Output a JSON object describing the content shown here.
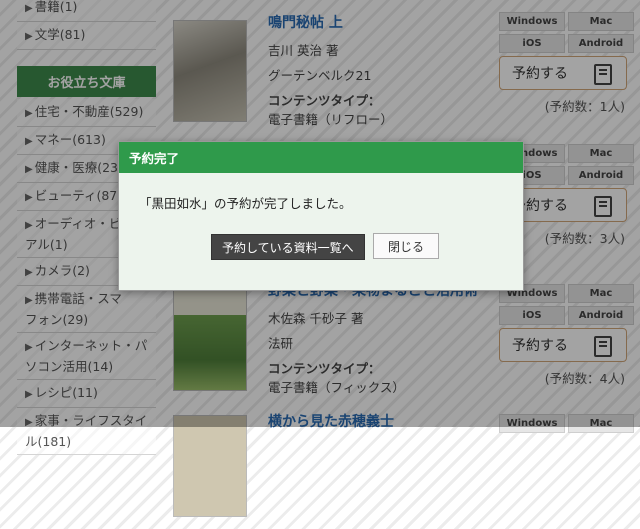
{
  "sidebar": {
    "top_items": [
      {
        "label": "書籍(1)"
      },
      {
        "label": "文学(81)"
      }
    ],
    "section_title": "お役立ち文庫",
    "items": [
      {
        "label": "住宅・不動産(529)"
      },
      {
        "label": "マネー(613)"
      },
      {
        "label": "健康・医療(23"
      },
      {
        "label": "ビューティ(87"
      },
      {
        "label": "オーディオ・ビ\nアル(1)"
      },
      {
        "label": "カメラ(2)"
      },
      {
        "label": "携帯電話・スマ\nフォン(29)"
      },
      {
        "label": "インターネット・パ\nソコン活用(14)"
      },
      {
        "label": "レシピ(11)"
      },
      {
        "label": "家事・ライフスタイ\nル(181)"
      }
    ]
  },
  "platforms": {
    "windows": "Windows",
    "mac": "Mac",
    "ios": "iOS",
    "android": "Android"
  },
  "reserve_label": "予約する",
  "books": [
    {
      "title": "鳴門秘帖 上",
      "author": "吉川 英治 著",
      "publisher": "グーテンベルク21",
      "content_type_label": "コンテンツタイプ：",
      "content_type": "電子書籍（リフロー）",
      "reserve_count": "(予約数：1人)"
    },
    {
      "reserve_count": "(予約数：3人)"
    },
    {
      "title": "野菜と野菜・果物まるごと活用術",
      "author": "木佐森 千砂子 著",
      "publisher": "法研",
      "content_type_label": "コンテンツタイプ：",
      "content_type": "電子書籍（フィックス）",
      "reserve_count": "(予約数：4人)"
    },
    {
      "title": "横から見た赤穂義士"
    }
  ],
  "modal": {
    "title": "予約完了",
    "message": "「黒田如水」の予約が完了しました。",
    "list_button": "予約している資料一覧へ",
    "close_button": "閉じる"
  }
}
